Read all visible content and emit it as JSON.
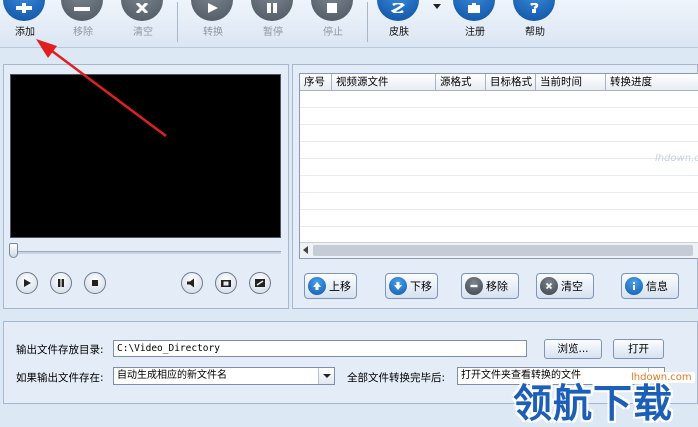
{
  "toolbar": {
    "buttons": [
      {
        "label": "添加",
        "icon": "plus-icon",
        "enabled": true
      },
      {
        "label": "移除",
        "icon": "minus-icon",
        "enabled": false
      },
      {
        "label": "清空",
        "icon": "clear-icon",
        "enabled": false
      },
      {
        "label": "转换",
        "icon": "play-icon",
        "enabled": false
      },
      {
        "label": "暂停",
        "icon": "pause-icon",
        "enabled": false
      },
      {
        "label": "停止",
        "icon": "stop-icon",
        "enabled": false
      },
      {
        "label": "皮肤",
        "icon": "skin-icon",
        "enabled": true
      },
      {
        "label": "注册",
        "icon": "register-icon",
        "enabled": true
      },
      {
        "label": "帮助",
        "icon": "help-icon",
        "enabled": true
      }
    ]
  },
  "list": {
    "columns": [
      "序号",
      "视频源文件",
      "源格式",
      "目标格式",
      "当前时间",
      "转换进度"
    ],
    "rows": []
  },
  "actions": {
    "up": "上移",
    "down": "下移",
    "remove": "移除",
    "clear": "清空",
    "info": "信息"
  },
  "output": {
    "dir_label": "输出文件存放目录:",
    "dir_value": "C:\\Video_Directory",
    "browse": "浏览...",
    "open": "打开",
    "exists_label": "如果输出文件存在:",
    "exists_value": "自动生成相应的新文件名",
    "after_label": "全部文件转换完毕后:",
    "after_value": "打开文件夹查看转换的文件"
  },
  "watermark": {
    "small": "lhdown.com",
    "site": "lhdown.com",
    "big": "领航下载"
  },
  "colors": {
    "annotation_arrow": "#e02020",
    "toolbar_dark": "#1a2028",
    "toolbar_blue": "#0d4e9e"
  }
}
